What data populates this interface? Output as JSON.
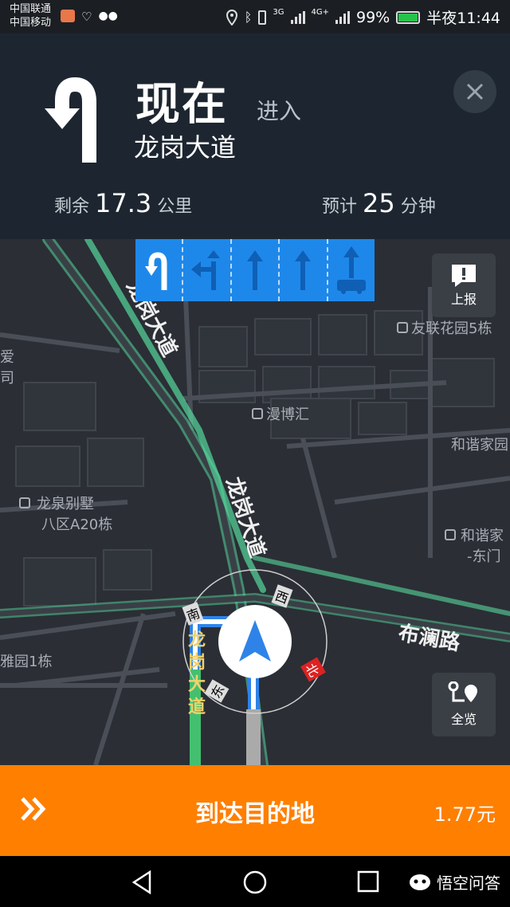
{
  "status_bar": {
    "carrier1": "中国联通",
    "carrier2": "中国移动",
    "net_3g": "3G",
    "net_4g": "4G+",
    "battery": "99%",
    "time": "半夜11:44"
  },
  "nav": {
    "action": "现在",
    "enter_label": "进入",
    "road_name": "龙岗大道",
    "remaining_prefix": "剩余",
    "remaining_value": "17.3",
    "remaining_unit": "公里",
    "eta_prefix": "预计",
    "eta_value": "25",
    "eta_unit": "分钟"
  },
  "map": {
    "report_label": "上报",
    "overview_label": "全览",
    "road_labels": [
      "龙岗大道",
      "龙岗大道",
      "布澜路",
      "龙岗大道"
    ],
    "pois": [
      "友联花园5栋",
      "漫博汇",
      "和谐家园",
      "和谐家",
      "-东门",
      "龙泉别墅",
      "八区A20栋",
      "雅园1栋",
      "爱",
      "司"
    ],
    "compass": {
      "north": "北",
      "east": "东",
      "south": "南",
      "west": "西"
    }
  },
  "bottom": {
    "destination": "到达目的地",
    "fare": "1.77元"
  },
  "sysnav": {
    "watermark": "悟空问答"
  },
  "colors": {
    "header_bg": "#1d2630",
    "lane_bg": "#1e88ea",
    "bottom_bg": "#ff7f00",
    "route_green": "#56d99d"
  }
}
